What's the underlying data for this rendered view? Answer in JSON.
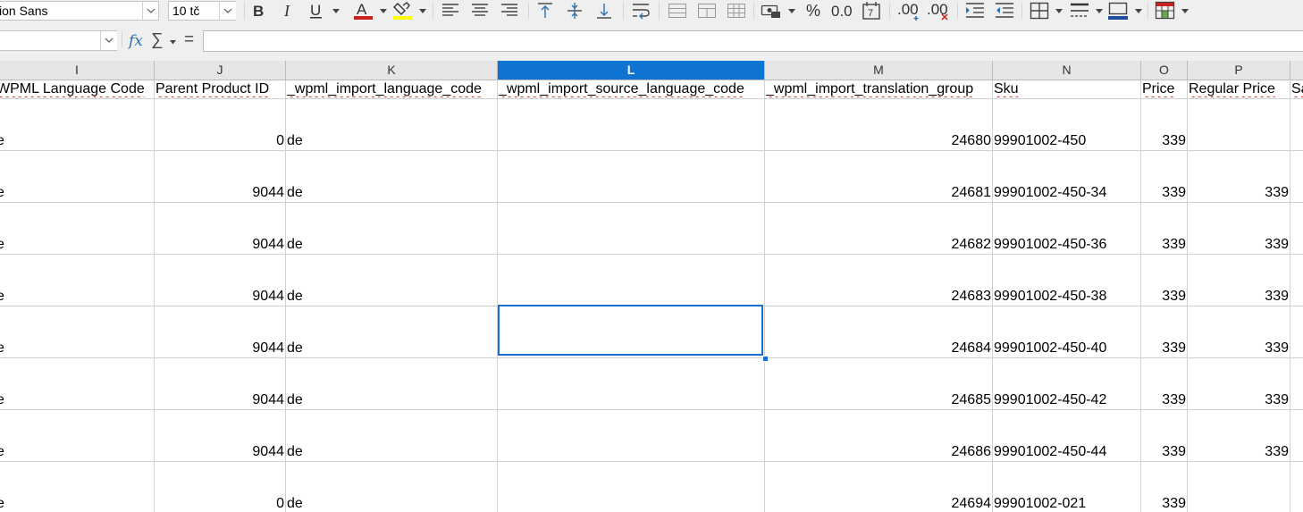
{
  "toolbar": {
    "font_name": "ion Sans",
    "font_size": "10 tč"
  },
  "formula_bar": {
    "name_box": "",
    "fx_label": "fx",
    "sigma_label": "∑",
    "equals_label": "=",
    "formula": ""
  },
  "columns": [
    {
      "letter": "I",
      "header": "WPML Language Code"
    },
    {
      "letter": "J",
      "header": "Parent Product ID"
    },
    {
      "letter": "K",
      "header": "_wpml_import_language_code"
    },
    {
      "letter": "L",
      "header": "_wpml_import_source_language_code"
    },
    {
      "letter": "M",
      "header": "_wpml_import_translation_group"
    },
    {
      "letter": "N",
      "header": "Sku"
    },
    {
      "letter": "O",
      "header": "Price"
    },
    {
      "letter": "P",
      "header": "Regular Price"
    },
    {
      "letter": "",
      "header": "Sa"
    }
  ],
  "rows": [
    {
      "i": "e",
      "j": "0",
      "k": "de",
      "l": "",
      "m": "24680",
      "n": "99901002-450",
      "o": "339",
      "p": ""
    },
    {
      "i": "e",
      "j": "9044",
      "k": "de",
      "l": "",
      "m": "24681",
      "n": "99901002-450-34",
      "o": "339",
      "p": "339"
    },
    {
      "i": "e",
      "j": "9044",
      "k": "de",
      "l": "",
      "m": "24682",
      "n": "99901002-450-36",
      "o": "339",
      "p": "339"
    },
    {
      "i": "e",
      "j": "9044",
      "k": "de",
      "l": "",
      "m": "24683",
      "n": "99901002-450-38",
      "o": "339",
      "p": "339"
    },
    {
      "i": "e",
      "j": "9044",
      "k": "de",
      "l": "",
      "m": "24684",
      "n": "99901002-450-40",
      "o": "339",
      "p": "339"
    },
    {
      "i": "e",
      "j": "9044",
      "k": "de",
      "l": "",
      "m": "24685",
      "n": "99901002-450-42",
      "o": "339",
      "p": "339"
    },
    {
      "i": "e",
      "j": "9044",
      "k": "de",
      "l": "",
      "m": "24686",
      "n": "99901002-450-44",
      "o": "339",
      "p": "339"
    },
    {
      "i": "e",
      "j": "0",
      "k": "de",
      "l": "",
      "m": "24694",
      "n": "99901002-021",
      "o": "339",
      "p": ""
    }
  ],
  "colors": {
    "selection": "#1a6fd2",
    "selected_header": "#0f73d2",
    "font_color_bar": "#c9211e",
    "highlight_bar": "#ffff00"
  }
}
